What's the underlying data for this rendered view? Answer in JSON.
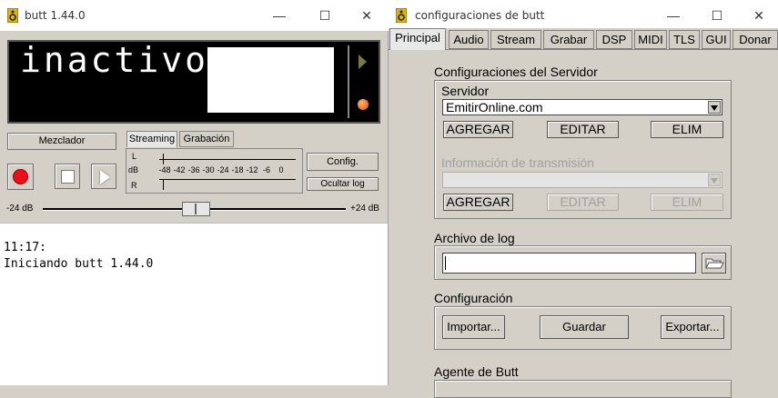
{
  "left_window": {
    "title": "butt 1.44.0",
    "controls": {
      "minimize": "—",
      "maximize": "☐",
      "close": "✕"
    },
    "display": {
      "status": "inactivo"
    },
    "mixer_label": "Mezclador",
    "tabs": [
      "Streaming",
      "Grabación"
    ],
    "vu": {
      "row_labels": [
        "L",
        "dB",
        "R"
      ],
      "scale": [
        "-48",
        "-42",
        "-36",
        "-30",
        "-24",
        "-18",
        "-12",
        "-6",
        "0"
      ]
    },
    "config_label": "Config.",
    "hide_log_label": "Ocultar log",
    "gain": {
      "min_label": "-24 dB",
      "max_label": "+24 dB",
      "value_db": 0
    },
    "log": [
      "11:17:",
      "Iniciando butt 1.44.0"
    ]
  },
  "right_window": {
    "title": "configuraciones de butt",
    "controls": {
      "minimize": "—",
      "maximize": "☐",
      "close": "✕"
    },
    "tabs": [
      "Principal",
      "Audio",
      "Stream",
      "Grabar",
      "DSP",
      "MIDI",
      "TLS",
      "GUI",
      "Donar"
    ],
    "active_tab": "Principal",
    "server_section": {
      "title": "Configuraciones del Servidor",
      "server_label": "Servidor",
      "server_value": "EmitirOnline.com",
      "buttons": [
        "AGREGAR",
        "EDITAR",
        "ELIM"
      ],
      "info_label": "Información de transmisión",
      "info_value": "",
      "info_buttons": [
        "AGREGAR",
        "EDITAR",
        "ELIM"
      ]
    },
    "log_section": {
      "title": "Archivo de log",
      "value": ""
    },
    "config_section": {
      "title": "Configuración",
      "buttons": [
        "Importar...",
        "Guardar",
        "Exportar..."
      ]
    },
    "agent_section": {
      "title": "Agente de Butt"
    }
  },
  "colors": {
    "display_bg": "#000000",
    "record": "#e8101a",
    "indicator": "#d2561a",
    "panel": "#d4d0c8"
  }
}
